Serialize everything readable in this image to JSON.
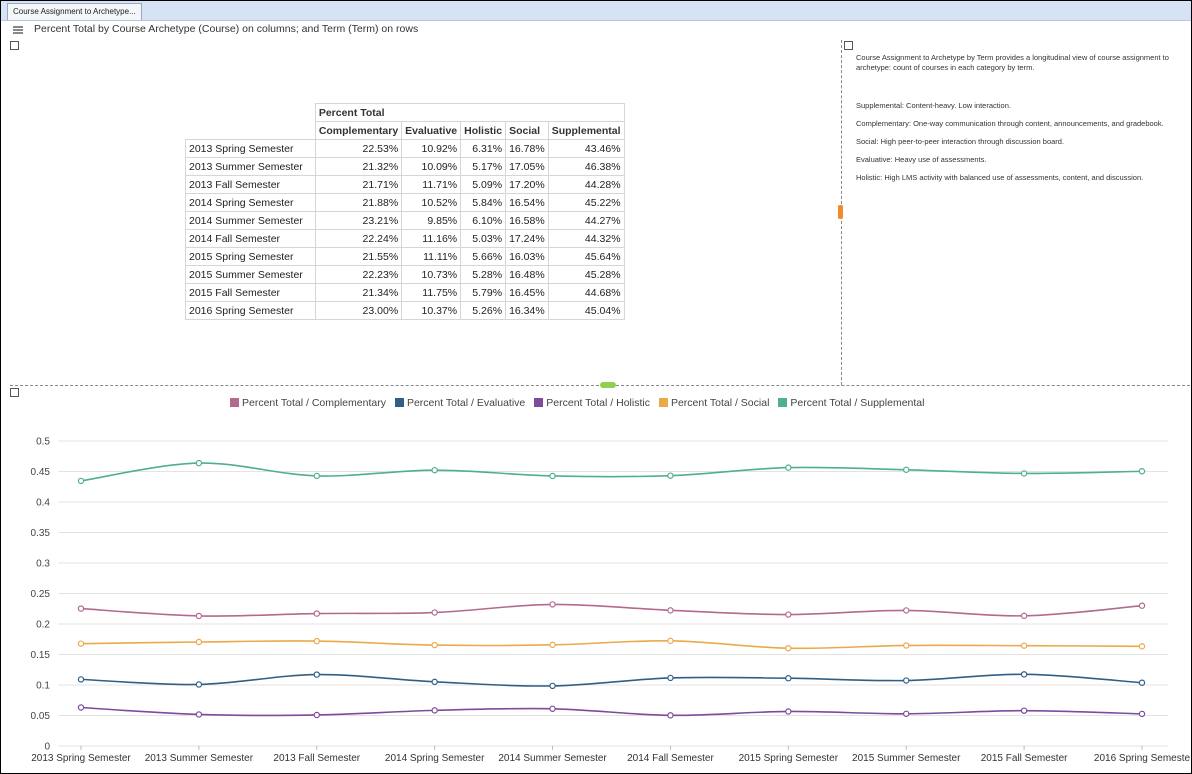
{
  "window": {
    "tab_label": "Course Assignment to Archetype...",
    "view_title": "Percent Total by Course Archetype (Course) on columns; and Term (Term) on rows"
  },
  "table": {
    "header_measure": "Percent Total",
    "columns": [
      "Complementary",
      "Evaluative",
      "Holistic",
      "Social",
      "Supplemental"
    ],
    "rows": [
      {
        "label": "2013 Spring Semester",
        "values": [
          "22.53%",
          "10.92%",
          "6.31%",
          "16.78%",
          "43.46%"
        ]
      },
      {
        "label": "2013 Summer Semester",
        "values": [
          "21.32%",
          "10.09%",
          "5.17%",
          "17.05%",
          "46.38%"
        ]
      },
      {
        "label": "2013 Fall Semester",
        "values": [
          "21.71%",
          "11.71%",
          "5.09%",
          "17.20%",
          "44.28%"
        ]
      },
      {
        "label": "2014 Spring Semester",
        "values": [
          "21.88%",
          "10.52%",
          "5.84%",
          "16.54%",
          "45.22%"
        ]
      },
      {
        "label": "2014 Summer Semester",
        "values": [
          "23.21%",
          "9.85%",
          "6.10%",
          "16.58%",
          "44.27%"
        ]
      },
      {
        "label": "2014 Fall Semester",
        "values": [
          "22.24%",
          "11.16%",
          "5.03%",
          "17.24%",
          "44.32%"
        ]
      },
      {
        "label": "2015 Spring Semester",
        "values": [
          "21.55%",
          "11.11%",
          "5.66%",
          "16.03%",
          "45.64%"
        ]
      },
      {
        "label": "2015 Summer Semester",
        "values": [
          "22.23%",
          "10.73%",
          "5.28%",
          "16.48%",
          "45.28%"
        ]
      },
      {
        "label": "2015 Fall Semester",
        "values": [
          "21.34%",
          "11.75%",
          "5.79%",
          "16.45%",
          "44.68%"
        ]
      },
      {
        "label": "2016 Spring Semester",
        "values": [
          "23.00%",
          "10.37%",
          "5.26%",
          "16.34%",
          "45.04%"
        ]
      }
    ]
  },
  "description": {
    "intro": "Course Assignment to Archetype by Term provides a longitudinal view of course assignment to archetype: count of courses in each category by term.",
    "items": [
      "Supplemental: Content-heavy. Low interaction.",
      "Complementary: One-way communication through content, announcements, and gradebook.",
      "Social: High peer-to-peer interaction through discussion board.",
      "Evaluative: Heavy use of assessments.",
      "Holistic: High LMS activity with balanced use of assessments, content, and discussion."
    ]
  },
  "chart_data": {
    "type": "line",
    "curve": "smooth",
    "x": [
      "2013 Spring Semester",
      "2013 Summer Semester",
      "2013 Fall Semester",
      "2014 Spring Semester",
      "2014 Summer Semester",
      "2014 Fall Semester",
      "2015 Spring Semester",
      "2015 Summer Semester",
      "2015 Fall Semester",
      "2016 Spring Semester"
    ],
    "x_tick_labels": [
      "2013 Spring Semester",
      "2013 Summer Semester",
      "2013 Fall Semester",
      "2014 Spring Semester",
      "2014 Summer Semester",
      "2014 Fall Semester",
      "2015 Spring Semester",
      "2015 Summer Semester",
      "2015 Fall Semester",
      "2016 Spring Semeste"
    ],
    "ylim": [
      0,
      0.5
    ],
    "y_ticks": [
      "0",
      "0.05",
      "0.1",
      "0.15",
      "0.2",
      "0.25",
      "0.3",
      "0.35",
      "0.4",
      "0.45",
      "0.5"
    ],
    "grid": true,
    "legend_position": "top",
    "series": [
      {
        "name": "Percent Total / Complementary",
        "color": "#b26a8e",
        "values": [
          0.2253,
          0.2132,
          0.2171,
          0.2188,
          0.2321,
          0.2224,
          0.2155,
          0.2223,
          0.2134,
          0.23
        ]
      },
      {
        "name": "Percent Total / Evaluative",
        "color": "#2f5f86",
        "values": [
          0.1092,
          0.1009,
          0.1171,
          0.1052,
          0.0985,
          0.1116,
          0.1111,
          0.1073,
          0.1175,
          0.1037
        ]
      },
      {
        "name": "Percent Total / Holistic",
        "color": "#7e4a9c",
        "values": [
          0.0631,
          0.0517,
          0.0509,
          0.0584,
          0.061,
          0.0503,
          0.0566,
          0.0528,
          0.0579,
          0.0526
        ]
      },
      {
        "name": "Percent Total / Social",
        "color": "#eda84a",
        "values": [
          0.1678,
          0.1705,
          0.172,
          0.1654,
          0.1658,
          0.1724,
          0.1603,
          0.1648,
          0.1645,
          0.1634
        ]
      },
      {
        "name": "Percent Total / Supplemental",
        "color": "#4fae94",
        "values": [
          0.4346,
          0.4638,
          0.4428,
          0.4522,
          0.4427,
          0.4432,
          0.4564,
          0.4528,
          0.4468,
          0.4504
        ]
      }
    ]
  }
}
